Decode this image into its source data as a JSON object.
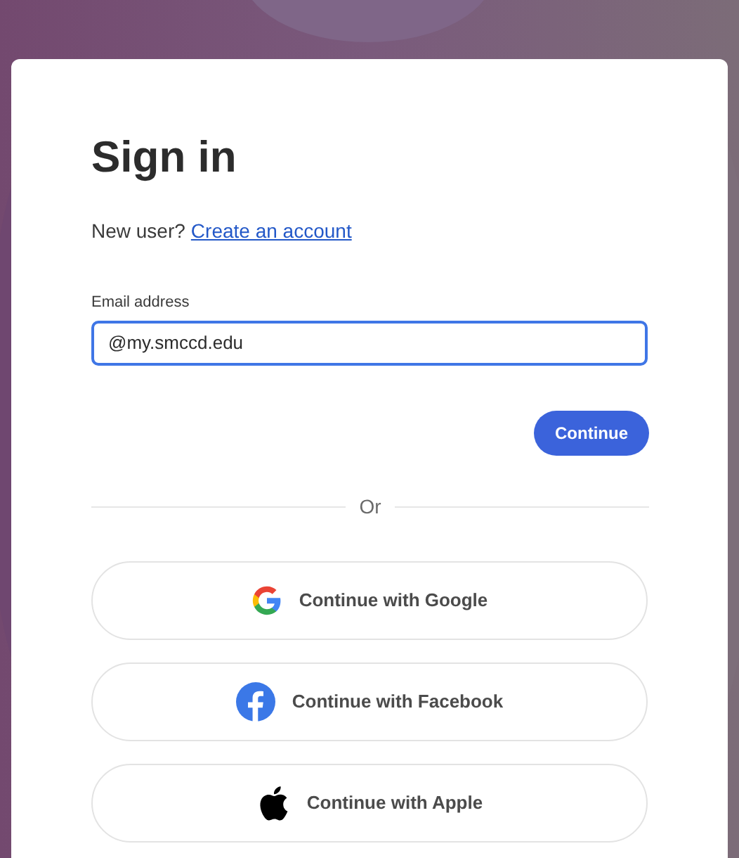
{
  "title": "Sign in",
  "new_user": {
    "prompt": "New user?",
    "link": "Create an account"
  },
  "email": {
    "label": "Email address",
    "value": "@my.smccd.edu"
  },
  "continue_button": "Continue",
  "divider": "Or",
  "social_buttons": [
    {
      "kind": "google",
      "label": "Continue with Google"
    },
    {
      "kind": "facebook",
      "label": "Continue with Facebook"
    },
    {
      "kind": "apple",
      "label": "Continue with Apple"
    }
  ]
}
